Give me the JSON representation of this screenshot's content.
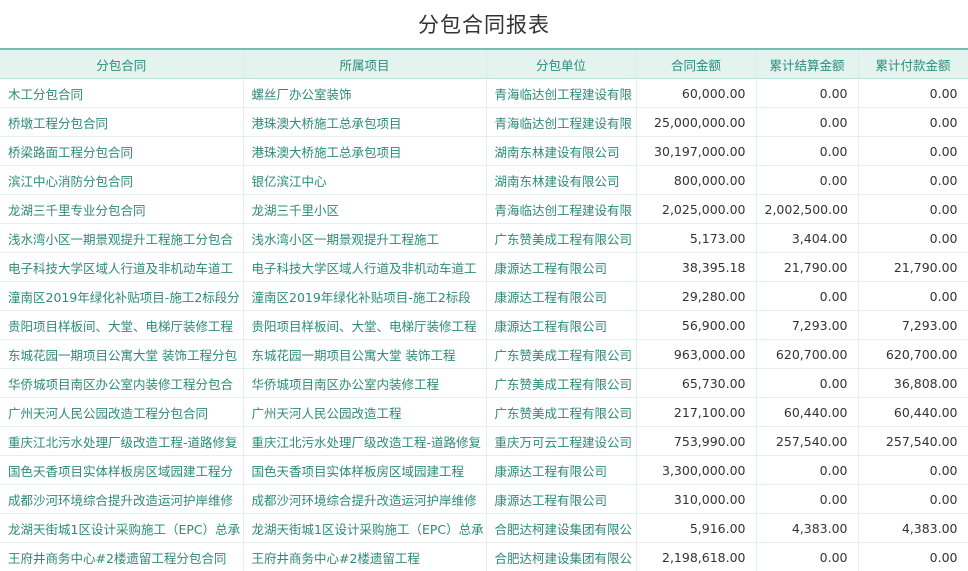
{
  "page": {
    "title": "分包合同报表"
  },
  "table": {
    "columns": [
      "分包合同",
      "所属项目",
      "分包单位",
      "合同金额",
      "累计结算金额",
      "累计付款金额"
    ],
    "rows": [
      [
        "木工分包合同",
        "螺丝厂办公室装饰",
        "青海临达创工程建设有限",
        "60,000.00",
        "0.00",
        "0.00"
      ],
      [
        "桥墩工程分包合同",
        "港珠澳大桥施工总承包项目",
        "青海临达创工程建设有限",
        "25,000,000.00",
        "0.00",
        "0.00"
      ],
      [
        "桥梁路面工程分包合同",
        "港珠澳大桥施工总承包项目",
        "湖南东林建设有限公司",
        "30,197,000.00",
        "0.00",
        "0.00"
      ],
      [
        "滨江中心消防分包合同",
        "银亿滨江中心",
        "湖南东林建设有限公司",
        "800,000.00",
        "0.00",
        "0.00"
      ],
      [
        "龙湖三千里专业分包合同",
        "龙湖三千里小区",
        "青海临达创工程建设有限",
        "2,025,000.00",
        "2,002,500.00",
        "0.00"
      ],
      [
        "浅水湾小区一期景观提升工程施工分包合",
        "浅水湾小区一期景观提升工程施工",
        "广东赞美成工程有限公司",
        "5,173.00",
        "3,404.00",
        "0.00"
      ],
      [
        "电子科技大学区域人行道及非机动车道工",
        "电子科技大学区域人行道及非机动车道工",
        "康源达工程有限公司",
        "38,395.18",
        "21,790.00",
        "21,790.00"
      ],
      [
        "潼南区2019年绿化补贴项目-施工2标段分",
        "潼南区2019年绿化补贴项目-施工2标段",
        "康源达工程有限公司",
        "29,280.00",
        "0.00",
        "0.00"
      ],
      [
        "贵阳项目样板间、大堂、电梯厅装修工程",
        "贵阳项目样板间、大堂、电梯厅装修工程",
        "康源达工程有限公司",
        "56,900.00",
        "7,293.00",
        "7,293.00"
      ],
      [
        "东城花园一期项目公寓大堂 装饰工程分包",
        "东城花园一期项目公寓大堂 装饰工程",
        "广东赞美成工程有限公司",
        "963,000.00",
        "620,700.00",
        "620,700.00"
      ],
      [
        "华侨城项目南区办公室内装修工程分包合",
        "华侨城项目南区办公室内装修工程",
        "广东赞美成工程有限公司",
        "65,730.00",
        "0.00",
        "36,808.00"
      ],
      [
        "广州天河人民公园改造工程分包合同",
        "广州天河人民公园改造工程",
        "广东赞美成工程有限公司",
        "217,100.00",
        "60,440.00",
        "60,440.00"
      ],
      [
        "重庆江北污水处理厂级改造工程-道路修复",
        "重庆江北污水处理厂级改造工程-道路修复",
        "重庆万可云工程建设公司",
        "753,990.00",
        "257,540.00",
        "257,540.00"
      ],
      [
        "国色天香项目实体样板房区域园建工程分",
        "国色天香项目实体样板房区域园建工程",
        "康源达工程有限公司",
        "3,300,000.00",
        "0.00",
        "0.00"
      ],
      [
        "成都沙河环境综合提升改造运河护岸维修",
        "成都沙河环境综合提升改造运河护岸维修",
        "康源达工程有限公司",
        "310,000.00",
        "0.00",
        "0.00"
      ],
      [
        "龙湖天街城1区设计采购施工（EPC）总承",
        "龙湖天街城1区设计采购施工（EPC）总承",
        "合肥达柯建设集团有限公",
        "5,916.00",
        "4,383.00",
        "4,383.00"
      ],
      [
        "王府井商务中心#2楼遗留工程分包合同",
        "王府井商务中心#2楼遗留工程",
        "合肥达柯建设集团有限公",
        "2,198,618.00",
        "0.00",
        "0.00"
      ]
    ]
  }
}
